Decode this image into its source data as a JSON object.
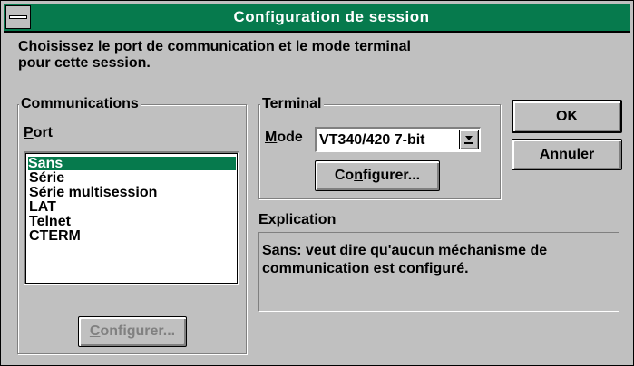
{
  "window": {
    "title": "Configuration de session"
  },
  "prompt": {
    "line1": "Choisissez le port de communication et le mode terminal",
    "line2": "pour cette session."
  },
  "communications": {
    "legend": "Communications",
    "port_label_key": "P",
    "port_label_rest": "ort",
    "ports": [
      "Sans",
      "Série",
      "Série multisession",
      "LAT",
      "Telnet",
      "CTERM"
    ],
    "selected_index": 0,
    "configure_key": "C",
    "configure_rest": "onfigurer..."
  },
  "terminal": {
    "legend": "Terminal",
    "mode_label_key": "M",
    "mode_label_rest": "ode",
    "mode_value": "VT340/420 7-bit",
    "configure_pre": "Co",
    "configure_key": "n",
    "configure_rest": "figurer..."
  },
  "explication": {
    "label": "Explication",
    "line1": "Sans: veut dire qu'aucun méchanisme de",
    "line2": "communication est configuré."
  },
  "buttons": {
    "ok": "OK",
    "cancel": "Annuler"
  },
  "colors": {
    "titlebar": "#067a4d",
    "selection": "#067a4d",
    "face": "#c0c0c0"
  },
  "icons": {
    "system_menu": "system-menu-icon",
    "combo_arrow": "down-arrow-icon"
  }
}
